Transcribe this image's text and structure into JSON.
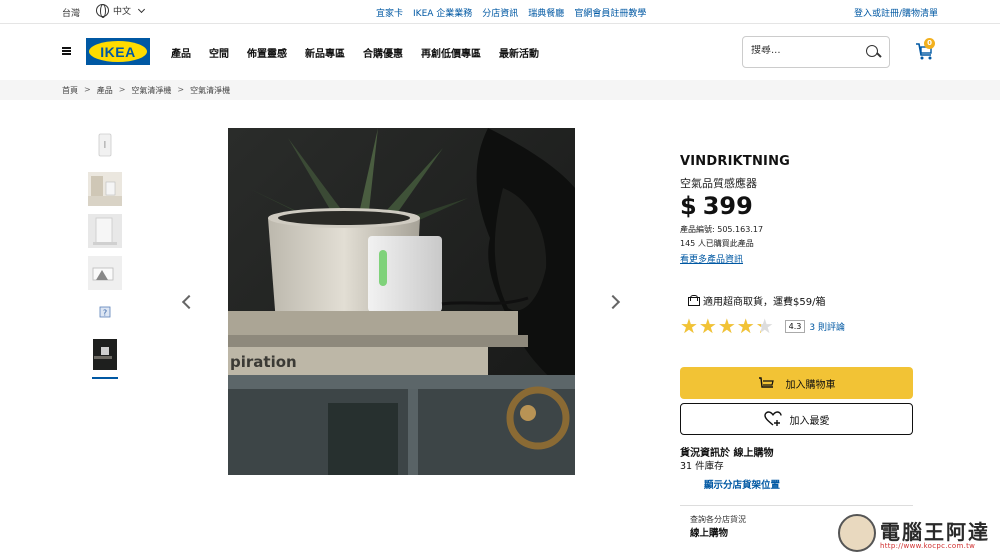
{
  "topbar": {
    "region": "台灣",
    "language": "中文",
    "links": [
      "宜家卡",
      "IKEA 企業業務",
      "分店資訊",
      "瑞典餐廳",
      "官網會員註冊教學"
    ],
    "login": "登入或註冊/購物清單"
  },
  "header": {
    "logo_text": "IKEA",
    "nav": [
      "產品",
      "空間",
      "佈置靈感",
      "新品專區",
      "合購優惠",
      "再創低價專區",
      "最新活動"
    ],
    "search_placeholder": "搜尋...",
    "cart_count": "0"
  },
  "breadcrumb": [
    "首頁",
    "產品",
    "空氣清淨機",
    "空氣清淨機"
  ],
  "product": {
    "name": "VINDRIKTNING",
    "description": "空氣品質感應器",
    "currency": "$",
    "price": "399",
    "product_id": "產品編號: 505.163.17",
    "bought": "145 人已購買此產品",
    "more_info": "看更多產品資訊",
    "delivery": "適用超商取貨，運費$59/箱",
    "rating_value": 4.3,
    "rating_score": "4.3",
    "reviews": "3 則評論",
    "add_to_cart": "加入購物車",
    "add_to_favorites": "加入最愛",
    "stock_title": "貨況資訊於 線上購物",
    "stock_count": "31 件庫存",
    "store_location_link": "顯示分店貨架位置",
    "check_store_label": "查詢各分店貨況",
    "check_store_value": "線上購物"
  },
  "image_text": "piration",
  "watermark": {
    "text": "電腦王阿達",
    "url": "http://www.kocpc.com.tw"
  },
  "colors": {
    "brand_blue": "#0058a3",
    "brand_yellow": "#ffdb00",
    "cart_button": "#f2c335",
    "star": "#f2c335"
  }
}
